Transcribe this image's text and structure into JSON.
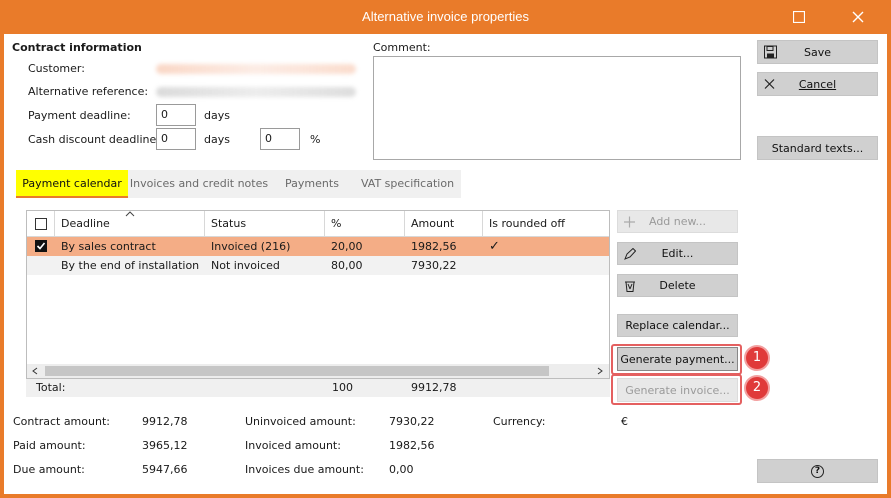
{
  "window": {
    "title": "Alternative invoice properties"
  },
  "contract": {
    "section_title": "Contract information",
    "customer_label": "Customer:",
    "alt_ref_label": "Alternative reference:",
    "payment_deadline_label": "Payment deadline:",
    "payment_deadline_value": "0",
    "payment_deadline_unit": "days",
    "cash_discount_label": "Cash discount deadline:",
    "cash_discount_value": "0",
    "cash_discount_unit": "days",
    "cash_discount_pct_value": "0",
    "cash_discount_pct_unit": "%"
  },
  "comment": {
    "label": "Comment:",
    "value": ""
  },
  "side_buttons": {
    "save": "Save",
    "cancel": "Cancel",
    "standard_texts": "Standard texts...",
    "help": "?"
  },
  "tabs": [
    {
      "label": "Payment calendar",
      "active": true
    },
    {
      "label": "Invoices and credit notes",
      "active": false
    },
    {
      "label": "Payments",
      "active": false
    },
    {
      "label": "VAT specification",
      "active": false
    }
  ],
  "table": {
    "columns": [
      "Deadline",
      "Status",
      "%",
      "Amount",
      "Is rounded off"
    ],
    "rows": [
      {
        "checked": true,
        "deadline": "By sales contract",
        "status": "Invoiced (216)",
        "pct": "20,00",
        "amount": "1982,56",
        "rounded": "✓"
      },
      {
        "checked": false,
        "deadline": "By the end of installation",
        "status": "Not invoiced",
        "pct": "80,00",
        "amount": "7930,22",
        "rounded": ""
      }
    ],
    "total_label": "Total:",
    "total_pct": "100",
    "total_amount": "9912,78"
  },
  "grid_buttons": {
    "add_new": "Add new...",
    "edit": "Edit...",
    "delete": "Delete",
    "replace_calendar": "Replace calendar...",
    "generate_payment": "Generate payment...",
    "generate_invoice": "Generate invoice..."
  },
  "badges": [
    "1",
    "2"
  ],
  "summary": {
    "contract_amount_label": "Contract amount:",
    "contract_amount": "9912,78",
    "paid_amount_label": "Paid amount:",
    "paid_amount": "3965,12",
    "due_amount_label": "Due amount:",
    "due_amount": "5947,66",
    "uninvoiced_label": "Uninvoiced amount:",
    "uninvoiced": "7930,22",
    "invoiced_label": "Invoiced amount:",
    "invoiced": "1982,56",
    "invoices_due_label": "Invoices due amount:",
    "invoices_due": "0,00",
    "currency_label": "Currency:",
    "currency": "€"
  },
  "colors": {
    "accent": "#e97b2a",
    "selected_row": "#f4ad86",
    "tab_highlight": "#ffff00",
    "badge": "#e03a3a"
  }
}
